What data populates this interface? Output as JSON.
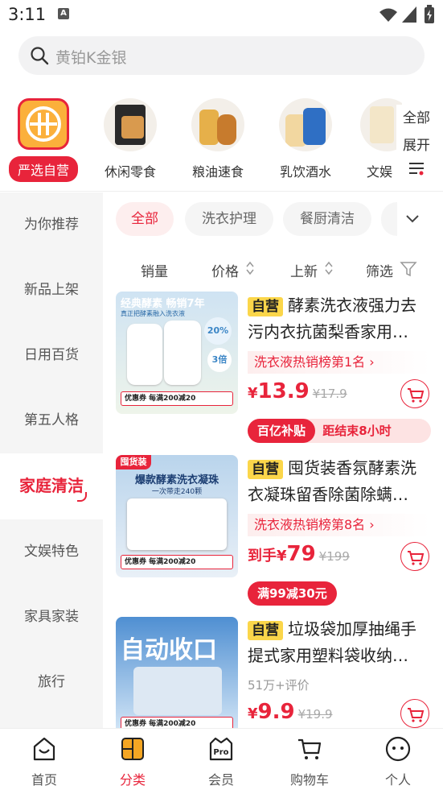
{
  "status": {
    "time": "3:11"
  },
  "search": {
    "placeholder": "黄铂K金银"
  },
  "categories": [
    {
      "label": "严选自营"
    },
    {
      "label": "休闲零食"
    },
    {
      "label": "粮油速食"
    },
    {
      "label": "乳饮酒水"
    },
    {
      "label": "文娱"
    }
  ],
  "all_expand": {
    "line1": "全部",
    "line2": "展开"
  },
  "sidebar": {
    "items": [
      {
        "label": "为你推荐"
      },
      {
        "label": "新品上架"
      },
      {
        "label": "日用百货"
      },
      {
        "label": "第五人格"
      },
      {
        "label": "家庭清洁"
      },
      {
        "label": "文娱特色"
      },
      {
        "label": "家具家装"
      },
      {
        "label": "旅行"
      }
    ]
  },
  "filters": {
    "chips": [
      {
        "label": "全部"
      },
      {
        "label": "洗衣护理"
      },
      {
        "label": "餐厨清洁"
      }
    ],
    "sort": {
      "sales": "销量",
      "price": "价格",
      "new": "上新",
      "filter": "筛选"
    }
  },
  "products": [
    {
      "tag": "自营",
      "title": "酵素洗衣液强力去污内衣抗菌梨香家用…",
      "rank": "洗衣液热销榜第1名",
      "price_prefix": "¥",
      "price": "13.9",
      "old_price": "¥17.9",
      "badge_main": "百亿补贴",
      "badge_extra": "距结束8小时",
      "img": {
        "line1": "经典酵素 畅销7年",
        "line2": "真正把酵素融入洗衣液",
        "pct": "20%",
        "times": "3倍",
        "coupon": "优惠券 每满200减20"
      }
    },
    {
      "tag": "自营",
      "title": "囤货装香氛酵素洗衣凝珠留香除菌除螨…",
      "rank": "洗衣液热销榜第8名",
      "price_prefix": "到手¥",
      "price": "79",
      "old_price": "¥199",
      "badge_main": "满99减30元",
      "img": {
        "line1": "囤货装",
        "line2": "爆款酵素洗衣凝珠",
        "line3": "一次带走240颗",
        "coupon": "优惠券 每满200减20"
      }
    },
    {
      "tag": "自营",
      "title": "垃圾袋加厚抽绳手提式家用塑料袋收纳…",
      "reviews": "51万+评价",
      "price_prefix": "¥",
      "price": "9.9",
      "old_price": "¥19.9",
      "img": {
        "line1": "自动收口",
        "coupon": "优惠券 每满200减20"
      }
    }
  ],
  "nav": [
    {
      "label": "首页"
    },
    {
      "label": "分类"
    },
    {
      "label": "会员"
    },
    {
      "label": "购物车"
    },
    {
      "label": "个人"
    }
  ],
  "colors": {
    "accent": "#e8243b",
    "tag_yellow": "#fbd64a"
  }
}
